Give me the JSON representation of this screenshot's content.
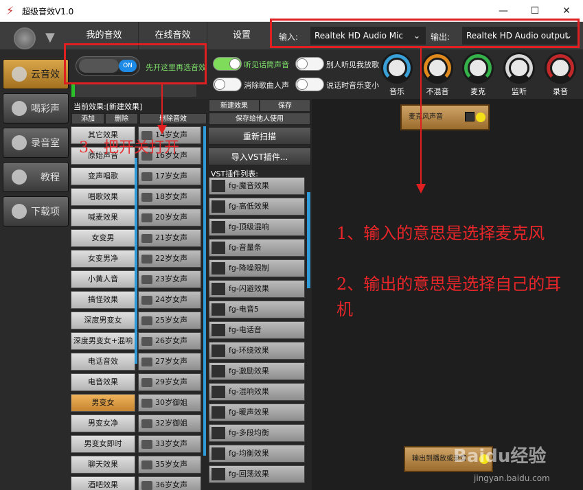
{
  "window": {
    "title": "超级音效V1.0",
    "controls": [
      "—",
      "☐",
      "✕"
    ]
  },
  "top_tabs": [
    "我的音效",
    "在线音效",
    "设置"
  ],
  "io": {
    "input_label": "输入:",
    "input_value": "Realtek HD Audio Mic input",
    "output_label": "输出:",
    "output_value": "Realtek HD Audio output"
  },
  "left_nav": [
    {
      "label": "云音效",
      "icon": "cloud-icon",
      "active": true
    },
    {
      "label": "喝彩声",
      "icon": "cheer-icon",
      "active": false
    },
    {
      "label": "录音室",
      "icon": "mic-icon",
      "active": false
    },
    {
      "label": "教程",
      "icon": "tutorial-icon",
      "active": false
    },
    {
      "label": "下载项",
      "icon": "download-icon",
      "active": false
    }
  ],
  "master_switch": {
    "state": "ON",
    "hint": "先开这里再选音效"
  },
  "options": [
    {
      "label": "听见话筒声音",
      "on": true
    },
    {
      "label": "别人听见我放歌",
      "on": false
    },
    {
      "label": "消除歌曲人声",
      "on": false
    },
    {
      "label": "说话时音乐变小",
      "on": false
    }
  ],
  "knobs": [
    {
      "label": "音乐",
      "color": "#3aa0d8"
    },
    {
      "label": "不混音",
      "color": "#e08a1e"
    },
    {
      "label": "麦克",
      "color": "#35b24a"
    },
    {
      "label": "监听",
      "color": "#d8d8d8"
    },
    {
      "label": "录音",
      "color": "#c0282a"
    }
  ],
  "current_effect": "当前效果:[新建效果]",
  "list_buttons": {
    "add": "添加",
    "delete": "删除",
    "delete_effect": "删除音效"
  },
  "category_list": [
    "其它效果",
    "原始声音",
    "变声唱歌",
    "唱歌效果",
    "喊麦效果",
    "女变男",
    "女变男净",
    "小黄人音",
    "搞怪效果",
    "深度男变女",
    "深度男变女+混响",
    "电话音效",
    "电音效果",
    "男变女",
    "男变女净",
    "男变女即时",
    "聊天效果",
    "酒吧效果"
  ],
  "selected_category": "男变女",
  "preset_list": [
    "14岁女声",
    "16岁女声",
    "17岁女声",
    "18岁女声",
    "20岁女声",
    "21岁女声",
    "22岁女声",
    "23岁女声",
    "24岁女声",
    "25岁女声",
    "26岁女声",
    "27岁女声",
    "29岁女声",
    "30岁御姐",
    "32岁御姐",
    "33岁女声",
    "35岁女声",
    "36岁女声"
  ],
  "vst_buttons": {
    "new": "新建效果",
    "save": "保存",
    "share": "保存给他人使用",
    "rescan": "重新扫描",
    "import": "导入VST插件..."
  },
  "vst_list_title": "VST插件列表:",
  "vst_list": [
    "fg-魔音效果",
    "fg-高低效果",
    "fg-顶级混响",
    "fg-音量条",
    "fg-降噪限制",
    "fg-闪避效果",
    "fg-电音5",
    "fg-电话音",
    "fg-环绕效果",
    "fg-激励效果",
    "fg-混响效果",
    "fg-暖声效果",
    "fg-多段均衡",
    "fg-均衡效果",
    "fg-回荡效果"
  ],
  "graph_nodes": {
    "mic": "麦克风声音",
    "output": "输出到播放或录音"
  },
  "annotations": {
    "step3": "3、把开关打开",
    "line1": "1、输入的意思是选择麦克风",
    "line2": "2、输出的意思是选择自己的耳机"
  },
  "watermark": {
    "brand": "Baidu经验",
    "url": "jingyan.baidu.com"
  }
}
